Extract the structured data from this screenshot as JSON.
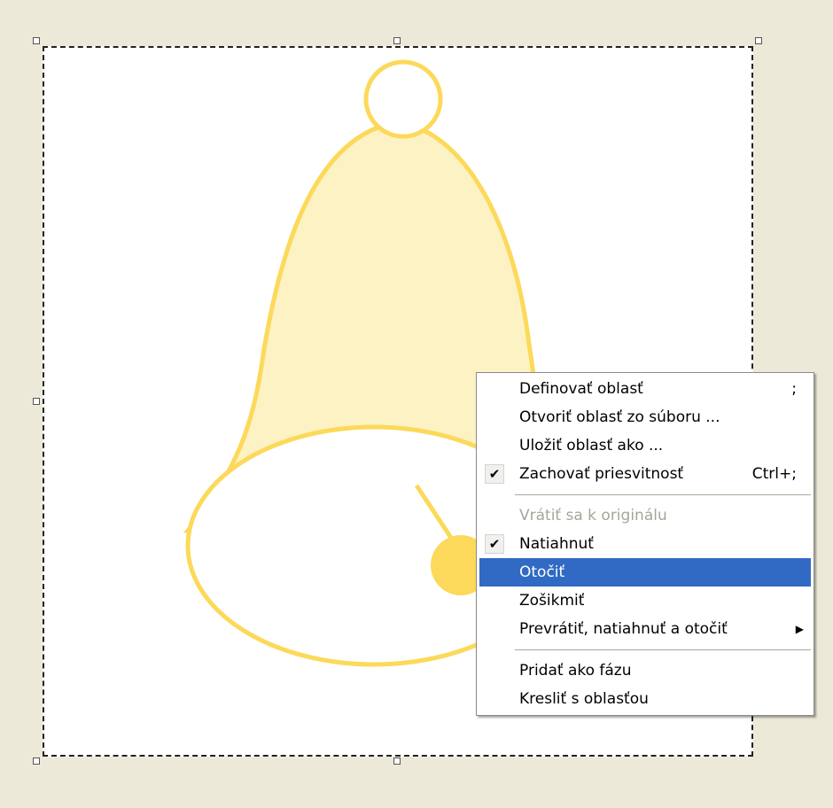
{
  "context_menu": {
    "items": [
      {
        "label": "Definovať oblasť",
        "shortcut": ";"
      },
      {
        "label": "Otvoriť oblasť zo súboru ..."
      },
      {
        "label": "Uložiť oblasť ako ..."
      },
      {
        "label": "Zachovať priesvitnosť",
        "shortcut": "Ctrl+;",
        "checked": true
      },
      {
        "label": "Vrátiť sa k originálu",
        "disabled": true
      },
      {
        "label": "Natiahnuť",
        "checked": true
      },
      {
        "label": "Otočiť",
        "highlighted": true
      },
      {
        "label": "Zošikmiť"
      },
      {
        "label": "Prevrátiť, natiahnuť a otočiť",
        "submenu": true
      },
      {
        "label": "Pridať ako fázu"
      },
      {
        "label": "Kresliť s oblasťou"
      }
    ],
    "check_glyph": "✔",
    "submenu_glyph": "▶"
  },
  "colors": {
    "background": "#ece9d8",
    "bell_stroke": "#fcd95a",
    "bell_fill": "#fdf2c4",
    "clapper": "#fcd95a",
    "highlight": "#316ac5"
  }
}
